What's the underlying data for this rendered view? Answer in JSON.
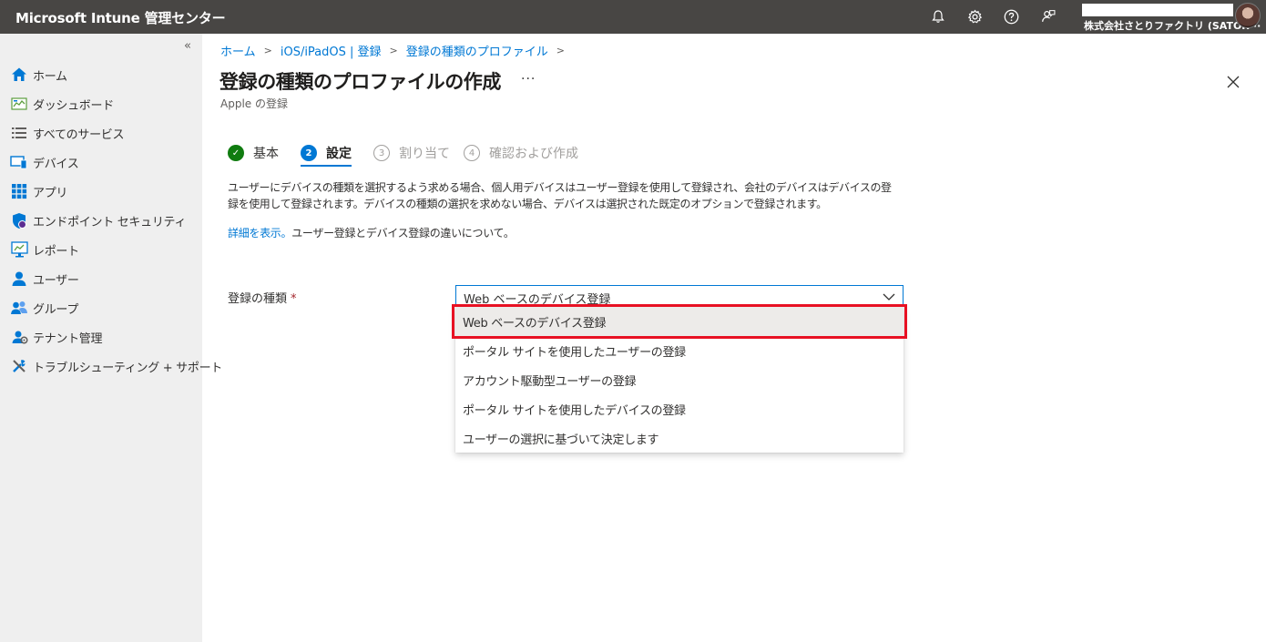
{
  "header": {
    "app_title": "Microsoft Intune 管理センター",
    "account_name": "株式会社さとりファクトリ (SATOR···",
    "icons": [
      "bell-icon",
      "gear-icon",
      "help-icon",
      "feedback-icon"
    ]
  },
  "sidebar": {
    "collapse_label": "«",
    "items": [
      {
        "label": "ホーム",
        "icon": "home-icon"
      },
      {
        "label": "ダッシュボード",
        "icon": "dashboard-icon"
      },
      {
        "label": "すべてのサービス",
        "icon": "list-icon"
      },
      {
        "label": "デバイス",
        "icon": "devices-icon"
      },
      {
        "label": "アプリ",
        "icon": "apps-icon"
      },
      {
        "label": "エンドポイント セキュリティ",
        "icon": "shield-icon"
      },
      {
        "label": "レポート",
        "icon": "reports-icon"
      },
      {
        "label": "ユーザー",
        "icon": "user-icon"
      },
      {
        "label": "グループ",
        "icon": "group-icon"
      },
      {
        "label": "テナント管理",
        "icon": "tenant-icon"
      },
      {
        "label": "トラブルシューティング + サポート",
        "icon": "wrench-icon"
      }
    ]
  },
  "breadcrumb": [
    "ホーム",
    "iOS/iPadOS | 登録",
    "登録の種類のプロファイル"
  ],
  "page": {
    "title": "登録の種類のプロファイルの作成",
    "more": "···",
    "subtitle": "Apple の登録"
  },
  "wizard": {
    "steps": [
      {
        "number": "✓",
        "label": "基本",
        "state": "done"
      },
      {
        "number": "2",
        "label": "設定",
        "state": "active"
      },
      {
        "number": "3",
        "label": "割り当て",
        "state": "pending"
      },
      {
        "number": "4",
        "label": "確認および作成",
        "state": "pending"
      }
    ]
  },
  "content": {
    "description": "ユーザーにデバイスの種類を選択するよう求める場合、個人用デバイスはユーザー登録を使用して登録され、会社のデバイスはデバイスの登録を使用して登録されます。デバイスの種類の選択を求めない場合、デバイスは選択された既定のオプションで登録されます。",
    "learn_link": "詳細を表示。",
    "learn_text": "ユーザー登録とデバイス登録の違いについて。",
    "field_label": "登録の種類",
    "required_mark": "*",
    "selected_value": "Web ベースのデバイス登録",
    "options": [
      "Web ベースのデバイス登録",
      "ポータル サイトを使用したユーザーの登録",
      "アカウント駆動型ユーザーの登録",
      "ポータル サイトを使用したデバイスの登録",
      "ユーザーの選択に基づいて決定します"
    ]
  },
  "colors": {
    "accent": "#0078d4",
    "topbar": "#484644",
    "sidebar": "#efefef",
    "highlight": "#e81123",
    "success": "#107c10"
  }
}
